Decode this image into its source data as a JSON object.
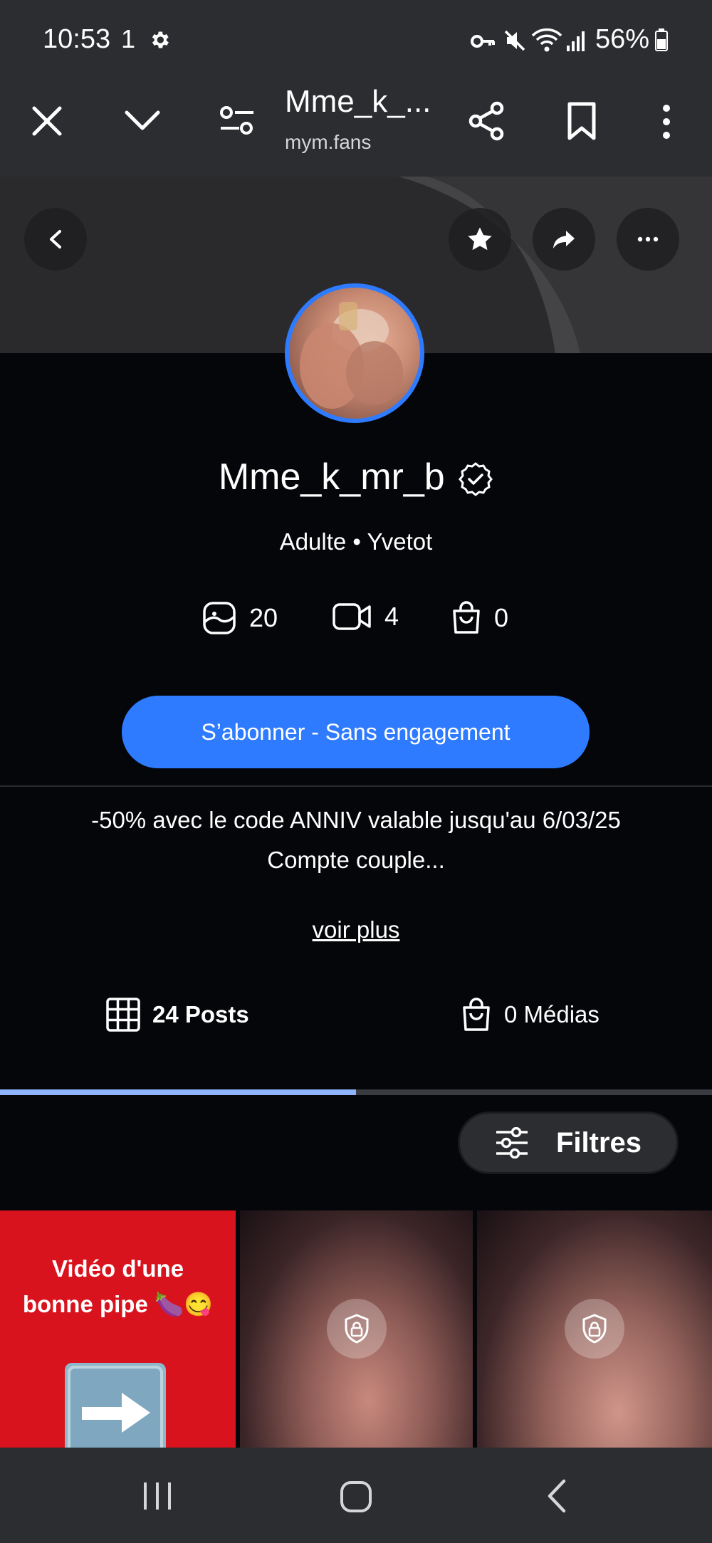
{
  "status_bar": {
    "time": "10:53",
    "notification_count": "1",
    "battery": "56%",
    "icons": [
      "gear-icon",
      "key-icon",
      "mute-icon",
      "wifi-icon",
      "signal-icon",
      "battery-icon"
    ]
  },
  "browser": {
    "tab_title": "Mme_k_...",
    "url": "mym.fans",
    "icons": [
      "close-icon",
      "chevron-down-icon",
      "site-settings-icon",
      "share-icon",
      "bookmark-icon",
      "more-vertical-icon"
    ]
  },
  "profile": {
    "name": "Mme_k_mr_b",
    "subtitle": "Adulte • Yvetot",
    "stats": {
      "photos": "20",
      "videos": "4",
      "products": "0"
    },
    "subscribe_label": "S’abonner - Sans engagement",
    "bio_line1": "-50% avec le code ANNIV valable jusqu'au 6/03/25",
    "bio_line2": "Compte couple...",
    "see_more": "voir plus"
  },
  "tabs": {
    "posts": "24 Posts",
    "medias": "0 Médias",
    "active_fraction": 0.5
  },
  "filters_label": "Filtres",
  "grid": {
    "tile1_line1": "Vidéo d'une",
    "tile1_line2": "bonne pipe 🍆😋"
  },
  "colors": {
    "accent": "#2f7bff",
    "tab_indicator": "#8fb3ff",
    "background": "#05060a"
  }
}
